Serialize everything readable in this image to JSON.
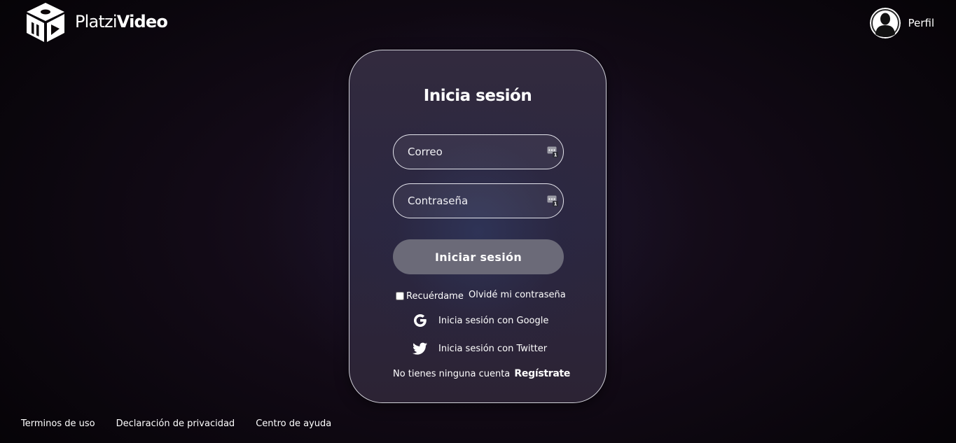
{
  "header": {
    "brand_light": "Platzi",
    "brand_bold": "Video",
    "profile_label": "Perfil"
  },
  "login": {
    "title": "Inicia sesión",
    "email_placeholder": "Correo",
    "password_placeholder": "Contraseña",
    "submit_label": "Iniciar sesión",
    "remember_label": "Recuérdame",
    "remember_checked": false,
    "forgot_label": "Olvidé mi contraseña",
    "google_label": "Inicia sesión con Google",
    "twitter_label": "Inicia sesión con Twitter",
    "no_account_text": "No tienes ninguna cuenta",
    "register_label": "Regístrate"
  },
  "footer": {
    "links": [
      "Terminos de uso",
      "Declaración de privacidad",
      "Centro de ayuda"
    ]
  },
  "colors": {
    "background": "#0b0609",
    "card": "#2e293c",
    "button": "#6b6a78",
    "text": "#ffffff"
  },
  "icons": {
    "logo": "platzi-video-cube-icon",
    "avatar": "user-avatar-icon",
    "password_manager": "password-manager-icon",
    "google": "google-g-icon",
    "twitter": "twitter-bird-icon"
  }
}
